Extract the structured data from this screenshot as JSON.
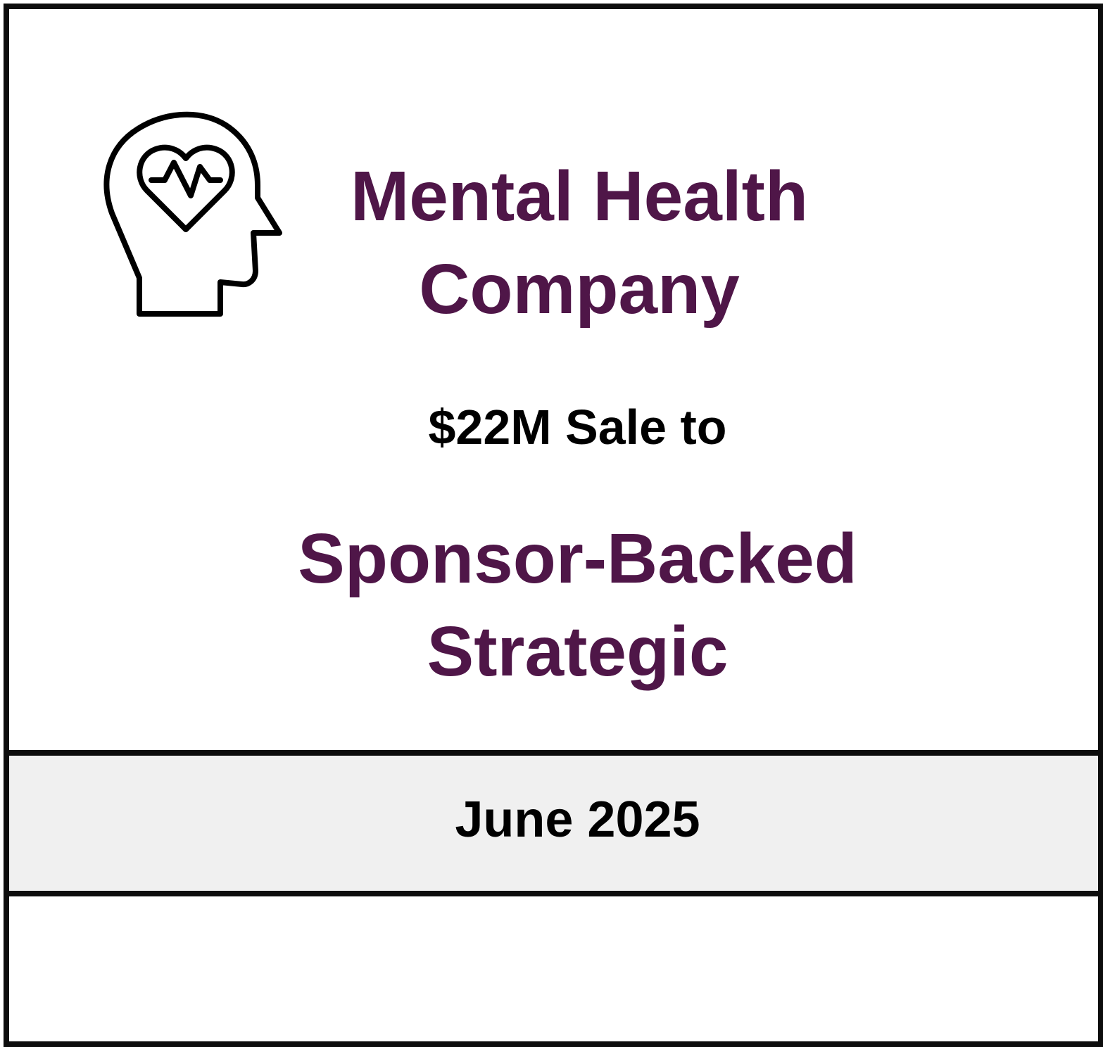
{
  "theme": {
    "accent_color": "#4f1648",
    "band_color": "#f0f0f0",
    "border_color": "#0d0d0d"
  },
  "icon": "head-heartbeat-icon",
  "company": {
    "line1": "Mental Health",
    "line2": "Company"
  },
  "deal": {
    "text": "$22M Sale to"
  },
  "buyer": {
    "line1": "Sponsor-Backed",
    "line2": "Strategic"
  },
  "date": "June 2025"
}
